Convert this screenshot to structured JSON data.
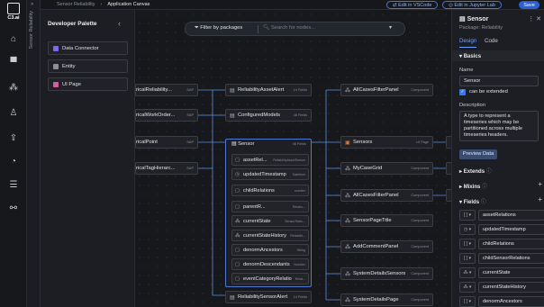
{
  "rail": {
    "logo_text": "C3.ai",
    "icons": [
      "home-icon",
      "apps-icon",
      "nodes-icon",
      "user-icon",
      "upload-icon",
      "gauge-icon",
      "database-icon",
      "share-icon"
    ]
  },
  "app_strip": {
    "label": "Sensor Reliability"
  },
  "topbar": {
    "crumbs": [
      "Sensor Reliability",
      "Application Canvas"
    ],
    "vscode_label": "Edit in VSCode",
    "jupyter_label": "Edit in Jupyter Lab",
    "save_label": "Save"
  },
  "palette": {
    "title": "Developer Palette",
    "items": [
      {
        "label": "Data Connector",
        "color": "#7b68ee"
      },
      {
        "label": "Entity",
        "color": "#8a8f98"
      },
      {
        "label": "UI Page",
        "color": "#d85aa0"
      }
    ]
  },
  "canvas": {
    "filter_label": "Filter by packages",
    "search_placeholder": "Search for nodes...",
    "left_nodes": [
      {
        "name": "ricalReliability...",
        "tag": "SAP"
      },
      {
        "name": "ricalWorkOrder...",
        "tag": "SAP"
      },
      {
        "name": "ricalPoint",
        "tag": "SAP"
      },
      {
        "name": "ricalTagHierarc...",
        "tag": "SAP"
      }
    ],
    "mid_nodes": [
      {
        "name": "ReliabilityAssetAlert",
        "tag": "14 Fields"
      },
      {
        "name": "ConfiguredModels",
        "tag": "48 Fields"
      },
      {
        "name": "ReliabilitySensorAlert",
        "tag": "14 Fields"
      }
    ],
    "sensor": {
      "title": "Sensor",
      "count": "48 Fields",
      "fields": [
        {
          "name": "assetRel...",
          "type": "ReliabilityAssetSensor"
        },
        {
          "name": "updatedTimestamp",
          "type": "Datetime"
        },
        {
          "name": "childRelations",
          "type": "number"
        },
        {
          "name": "parentR...",
          "type": "Relatio..."
        },
        {
          "name": "currentState",
          "type": "SensorStatu..."
        },
        {
          "name": "currentStateHistory",
          "type": "Reliabilit..."
        },
        {
          "name": "denormAncestors",
          "type": "String"
        },
        {
          "name": "denormDescendants",
          "type": "Number"
        },
        {
          "name": "eventCategoryRelatio",
          "type": "Relat..."
        }
      ]
    },
    "right_nodes": [
      {
        "name": "AllCasesFilterPanel",
        "tag": "Component"
      },
      {
        "name": "Sensors",
        "tag": "UI Page"
      },
      {
        "name": "MyCaseGrid",
        "tag": "Component"
      },
      {
        "name": "AllCasesFilterPanel",
        "tag": "Component"
      },
      {
        "name": "SensorPageTitle",
        "tag": "Component"
      },
      {
        "name": "AddCommentPanel",
        "tag": "Component"
      },
      {
        "name": "SystemDetailsSensors",
        "tag": "Component"
      },
      {
        "name": "SystemDetailsPage",
        "tag": "Component"
      }
    ]
  },
  "inspector": {
    "title": "Sensor",
    "subtitle": "Package: Reliability",
    "tabs": [
      "Design",
      "Code"
    ],
    "basics_label": "Basics",
    "name_label": "Name",
    "name_value": "Sensor",
    "extend_label": "can be extended",
    "desc_label": "Description",
    "desc_value": "A type to represent a timeseries which may be partitioned across multiple timeseries headers.",
    "preview_label": "Preview Data",
    "extends_label": "Extends",
    "mixins_label": "Mixins",
    "fields_label": "Fields",
    "fields": [
      {
        "type": "[ ] ▾",
        "name": "assetRelations"
      },
      {
        "type": "◷ ▾",
        "name": "updatedTimestamp"
      },
      {
        "type": "[ ] ▾",
        "name": "childRelations"
      },
      {
        "type": "[ ] ▾",
        "name": "childSensorRelations"
      },
      {
        "type": "⁂ ▾",
        "name": "currentState"
      },
      {
        "type": "⁂ ▾",
        "name": "currentStateHistory"
      },
      {
        "type": "[ ] ▾",
        "name": "denormAncestors"
      }
    ]
  }
}
